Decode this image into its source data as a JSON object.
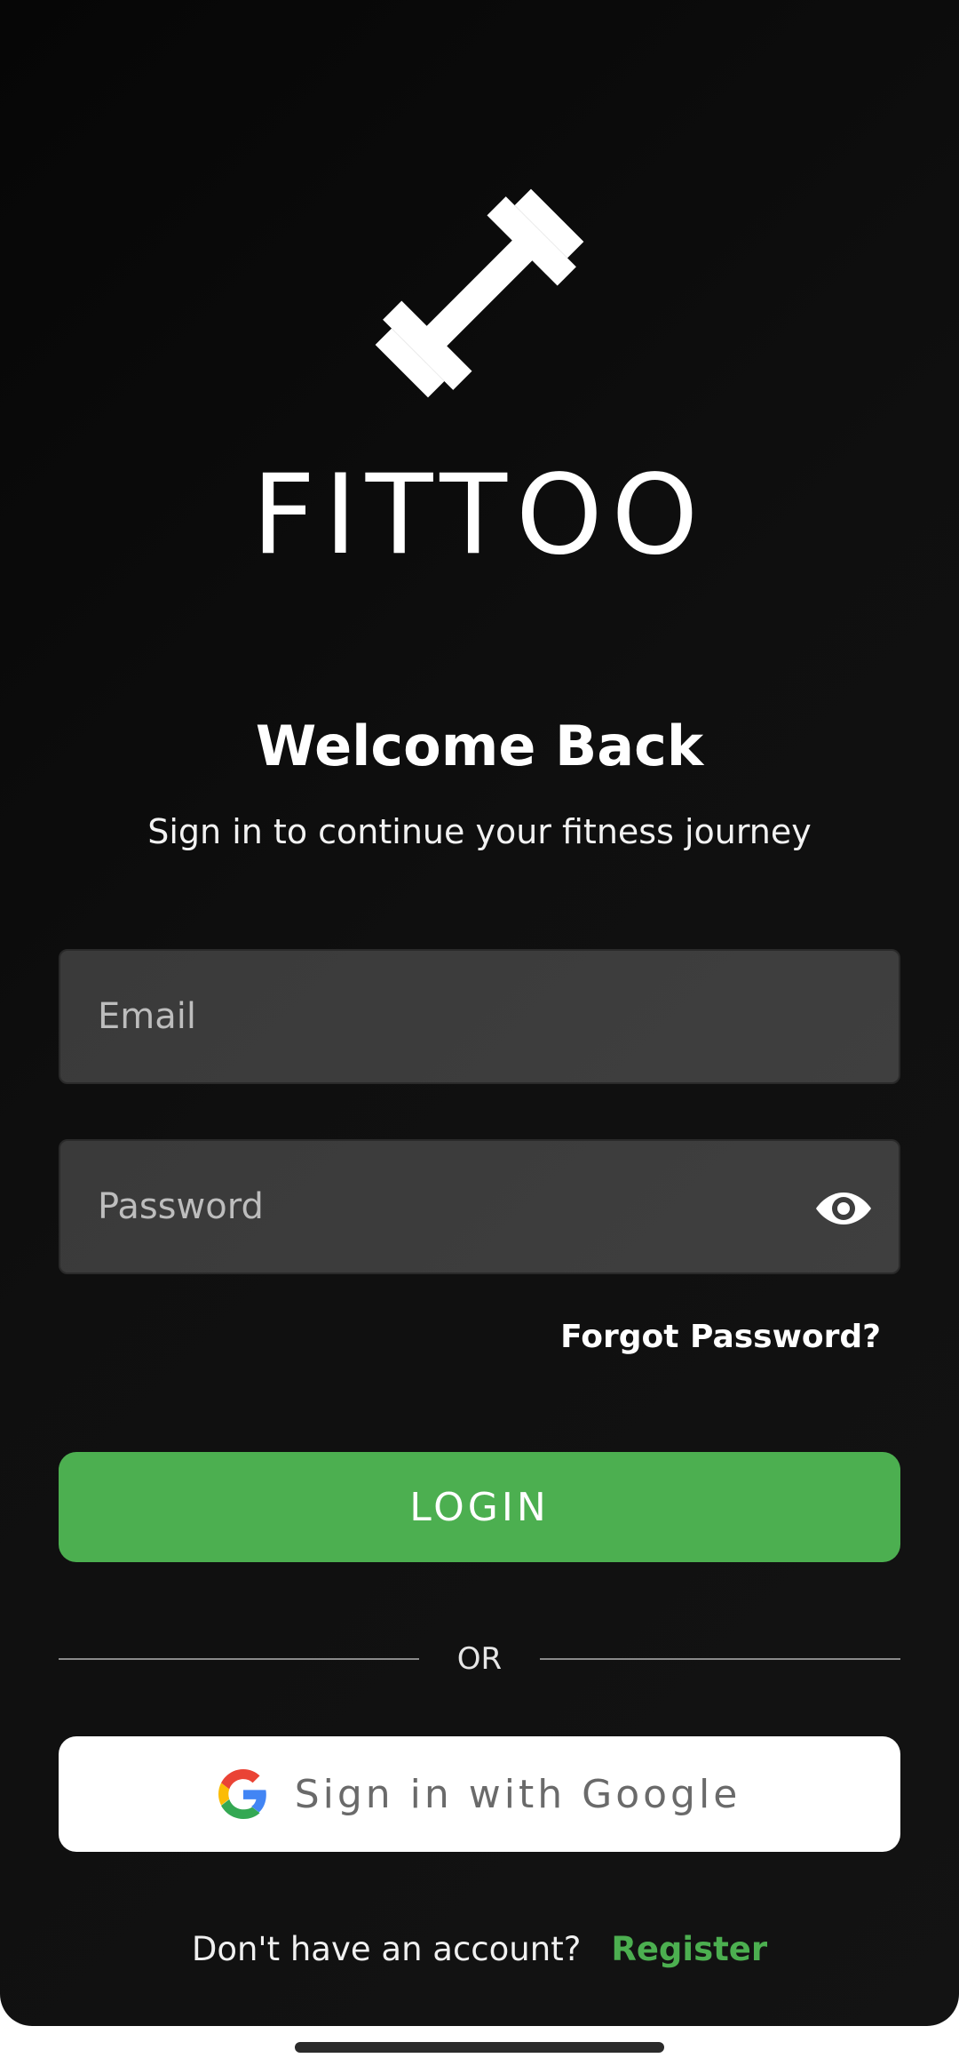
{
  "brand": {
    "name": "FITTOO"
  },
  "header": {
    "welcome": "Welcome Back",
    "subtitle": "Sign in to continue your fitness journey"
  },
  "form": {
    "email_placeholder": "Email",
    "email_value": "",
    "password_placeholder": "Password",
    "password_value": "",
    "forgot_label": "Forgot Password?",
    "login_label": "LOGIN"
  },
  "divider": {
    "label": "OR"
  },
  "google": {
    "label": "Sign in with Google"
  },
  "register": {
    "prompt": "Don't have an account?",
    "link_label": "Register"
  },
  "icons": {
    "logo": "dumbbell-icon",
    "password_toggle": "eye-icon",
    "google": "google-logo-icon"
  },
  "colors": {
    "background": "#0a0a0a",
    "input_bg": "#3c3c3c",
    "accent_green": "#4caf50",
    "google_button_bg": "#ffffff"
  }
}
